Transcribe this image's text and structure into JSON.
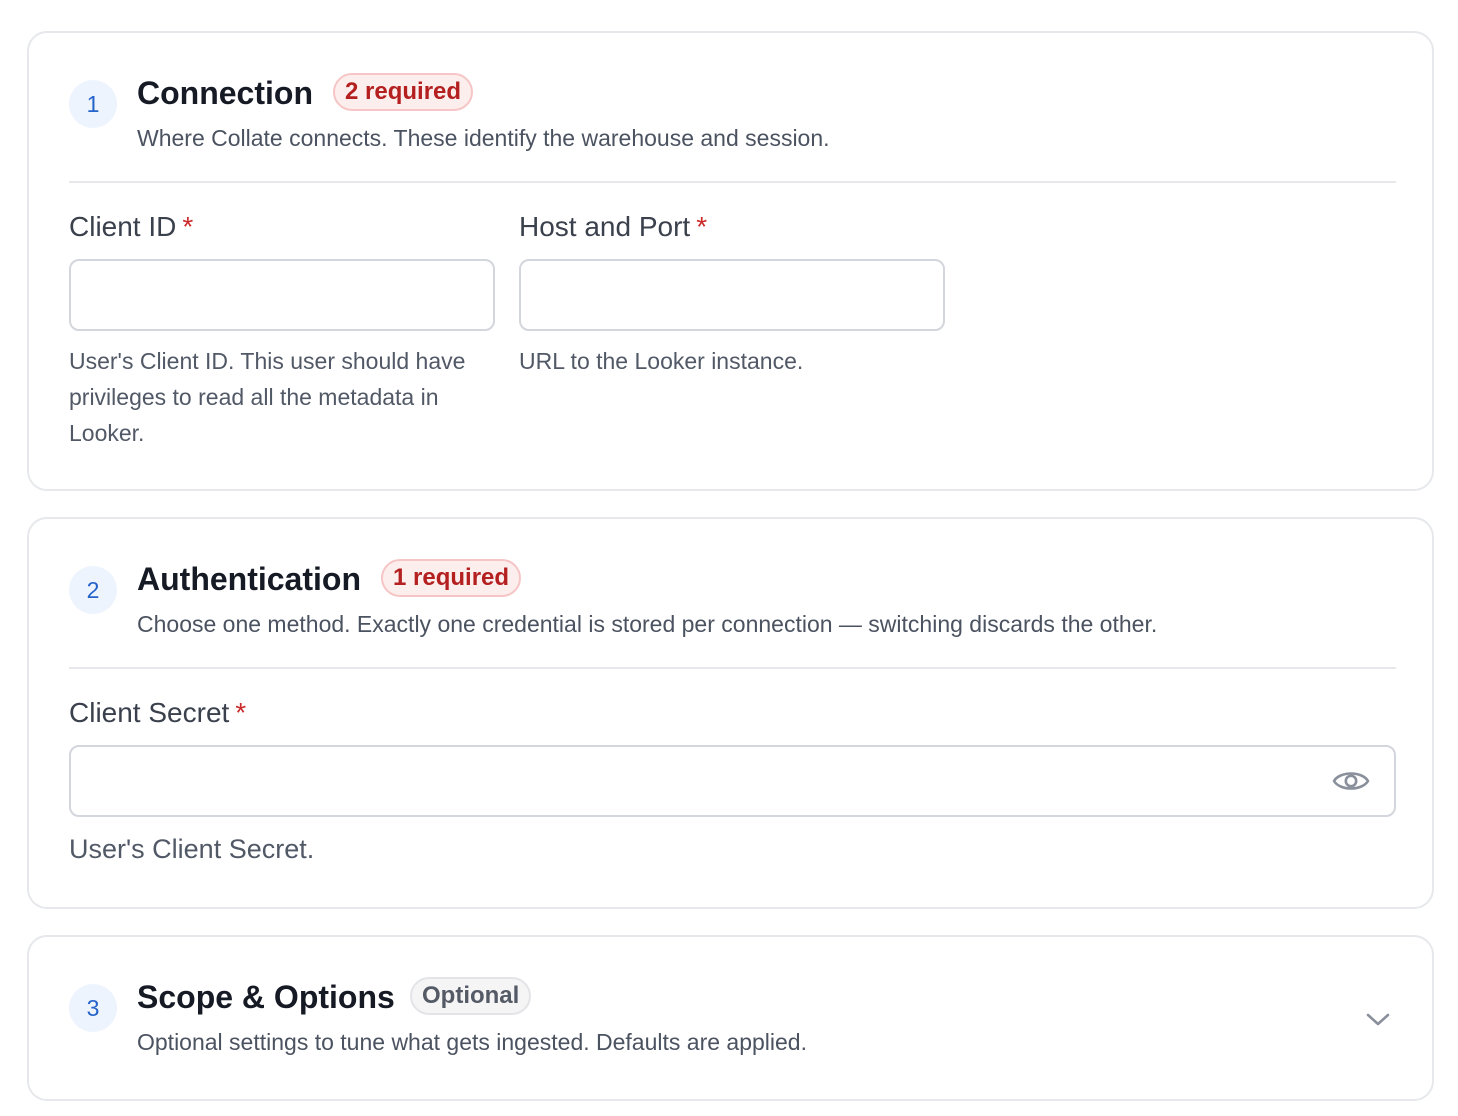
{
  "sections": [
    {
      "number": "1",
      "title": "Connection",
      "badge": "2 required",
      "description": "Where Collate connects. These identify the warehouse and session.",
      "fields": [
        {
          "label": "Client ID",
          "required_mark": "*",
          "value": "",
          "help": "User's Client ID. This user should have privileges to read all the metadata in Looker."
        },
        {
          "label": "Host and Port",
          "required_mark": "*",
          "value": "",
          "help": "URL to the Looker instance."
        }
      ]
    },
    {
      "number": "2",
      "title": "Authentication",
      "badge": "1 required",
      "description": "Choose one method. Exactly one credential is stored per connection — switching discards the other.",
      "fields": [
        {
          "label": "Client Secret",
          "required_mark": "*",
          "value": "",
          "help": "User's Client Secret."
        }
      ]
    },
    {
      "number": "3",
      "title": "Scope & Options",
      "badge": "Optional",
      "description": "Optional settings to tune what gets ingested. Defaults are applied.",
      "collapsed": true
    }
  ],
  "icons": {
    "password_toggle": "eye-icon",
    "expand": "chevron-down-icon"
  },
  "colors": {
    "step_accent": "#2463c9",
    "required_badge": "#b42020",
    "required_star": "#cc2a2a"
  }
}
